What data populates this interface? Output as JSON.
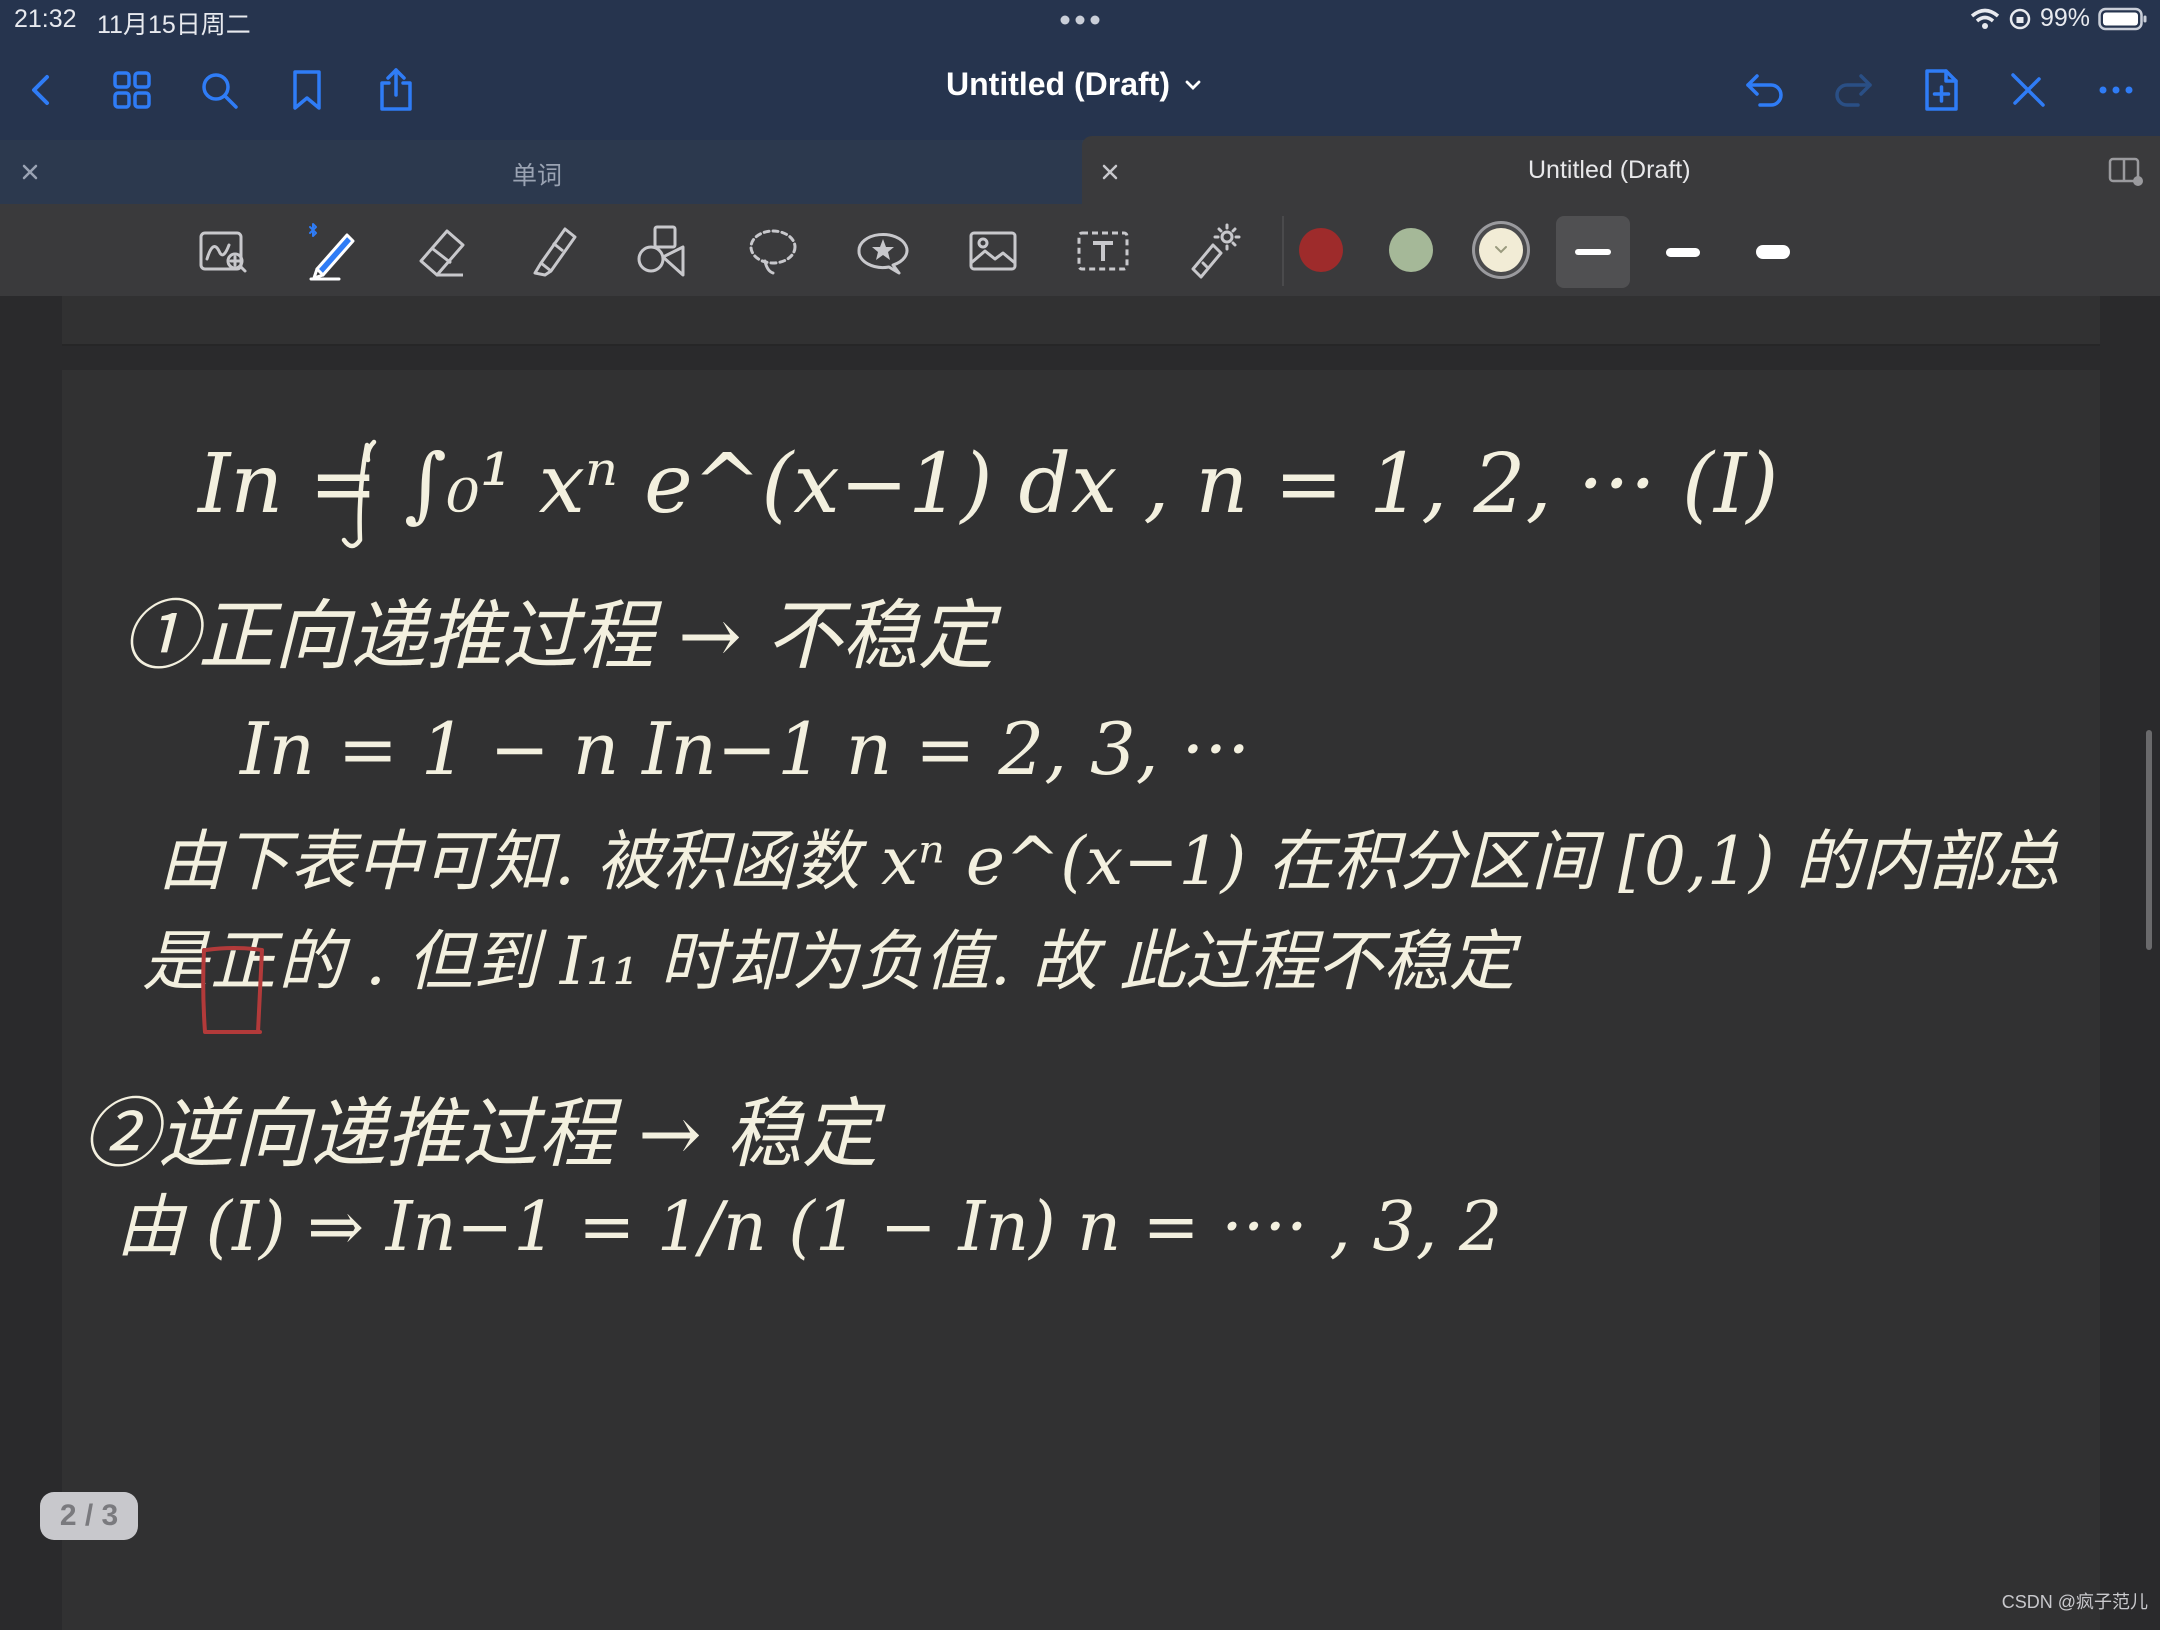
{
  "status_bar": {
    "time": "21:32",
    "date": "11月15日周二",
    "battery": "99%"
  },
  "nav": {
    "title": "Untitled (Draft)"
  },
  "tabs": [
    {
      "label": "单词"
    },
    {
      "label": "Untitled (Draft)"
    }
  ],
  "toolbar": {
    "tools": [
      "zoom-window-icon",
      "pen-icon",
      "eraser-icon",
      "highlighter-icon",
      "shapes-icon",
      "lasso-icon",
      "sticker-icon",
      "image-icon",
      "text-icon",
      "laser-pointer-icon"
    ],
    "colors": [
      "#9e2b2b",
      "#a5b898",
      "#f2ecd6"
    ],
    "selected_color": "#f2ecd6",
    "selected_thickness_index": 0
  },
  "notes": {
    "line1": "In = ∫₀¹ xⁿ e^(x−1) dx ,  n = 1, 2, ···    (I)",
    "line2": "①正向递推过程 → 不稳定",
    "line3": "In = 1 − n In−1    n = 2, 3, ···",
    "line4": "由下表中可知. 被积函数 xⁿ e^(x−1) 在积分区间 [0,1) 的内部总",
    "line5a": "是",
    "line5b": "正",
    "line5c": "的 . 但到 I₁₁ 时却为负值. 故 此过程不稳定",
    "line6": "②逆向递推过程 → 稳定",
    "line7": "由 (I) ⇒    In−1 = 1/n (1 − In)    n = ···· , 3, 2"
  },
  "page_indicator": "2 / 3",
  "watermark": "CSDN @疯子范儿"
}
